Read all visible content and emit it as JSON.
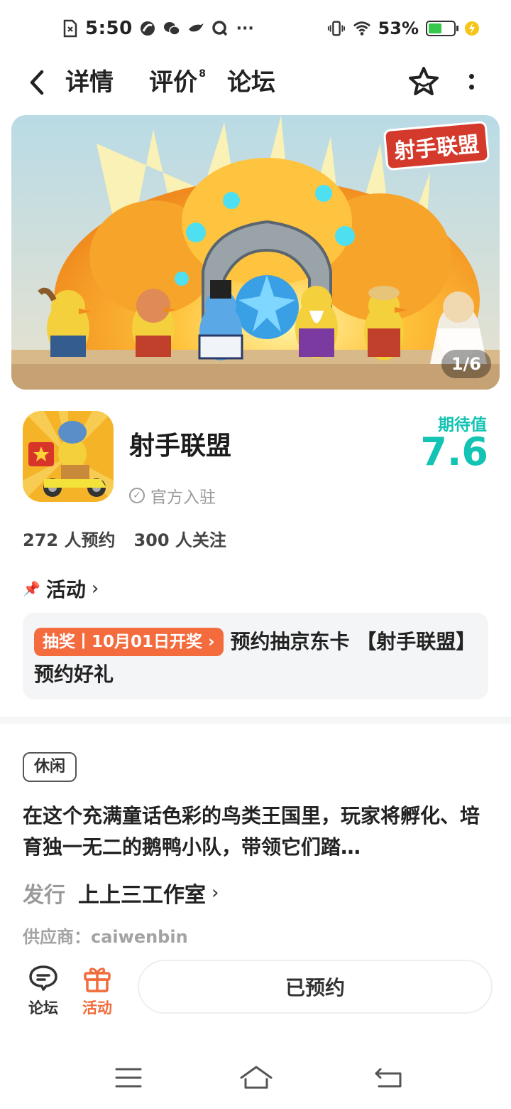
{
  "status_bar": {
    "time": "5:50",
    "dots": "···",
    "battery_percent": "53%",
    "battery_level": 0.53,
    "icons": [
      "sim-icon",
      "app-icon-1",
      "wechat-icon",
      "bird-icon",
      "q-icon",
      "vibrate-icon",
      "wifi-icon",
      "battery-icon",
      "charging-icon"
    ]
  },
  "nav": {
    "tabs": [
      {
        "label": "详情",
        "active": true
      },
      {
        "label": "评价",
        "badge": "8"
      },
      {
        "label": "论坛"
      }
    ]
  },
  "banner": {
    "logo_text": "射手联盟",
    "counter": "1/6"
  },
  "app": {
    "name": "射手联盟",
    "official_label": "官方入驻",
    "expect_label": "期待值",
    "expect_value": "7.6",
    "reservations": "272 人预约",
    "followers": "300 人关注"
  },
  "activity": {
    "heading": "活动",
    "badge": "抽奖丨10月01日开奖 ›",
    "text": "预约抽京东卡 【射手联盟】预约好礼"
  },
  "details": {
    "tag": "休闲",
    "description": "在这个充满童话色彩的鸟类王国里，玩家将孵化、培育独一无二的鹅鸭小队，带领它们踏…",
    "publisher_label": "发行",
    "publisher_value": "上上三工作室",
    "supplier": "供应商：caiwenbin"
  },
  "bottom_bar": {
    "forum_label": "论坛",
    "event_label": "活动",
    "reserved_label": "已预约"
  },
  "colors": {
    "accent": "#17c6be",
    "orange": "#f46b3d"
  }
}
